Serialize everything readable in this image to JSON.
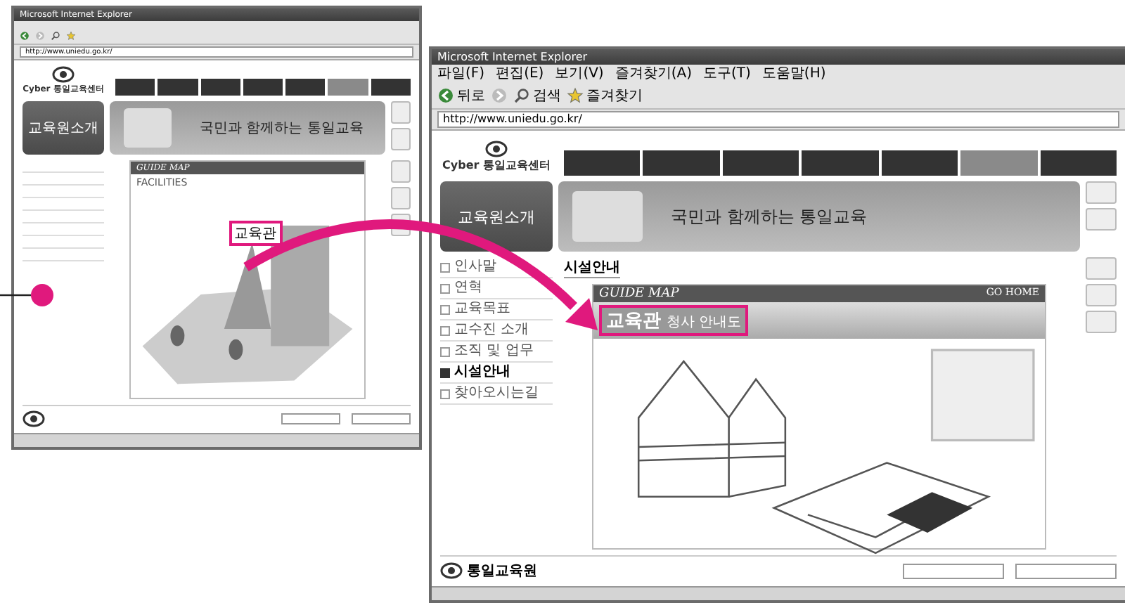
{
  "source_window": {
    "title": "Microsoft Internet Explorer",
    "nav_tabs": [
      {
        "selected": false
      },
      {
        "selected": false
      },
      {
        "selected": false
      },
      {
        "selected": false
      },
      {
        "selected": false
      },
      {
        "selected": true
      },
      {
        "selected": false
      }
    ],
    "toolbar": [
      {
        "kind": "back"
      },
      {
        "kind": "forward"
      },
      {
        "kind": "search"
      },
      {
        "kind": "favorites"
      }
    ],
    "address": "http://www.uniedu.go.kr/",
    "logo": "Cyber 통일교육센터",
    "section_title": "교육원소개",
    "banner_slogan": "국민과 함께하는 통일교육",
    "map_title": "GUIDE MAP",
    "map_subtitle": "FACILITIES",
    "callout": {
      "text": "교육관",
      "highlighted": true
    }
  },
  "target_window": {
    "title": "Microsoft Internet Explorer",
    "nav_tabs": [
      {
        "selected": false
      },
      {
        "selected": false
      },
      {
        "selected": false
      },
      {
        "selected": false
      },
      {
        "selected": false
      },
      {
        "selected": true
      },
      {
        "selected": false
      }
    ],
    "menu": [
      "파일(F)",
      "편집(E)",
      "보기(V)",
      "즐겨찾기(A)",
      "도구(T)",
      "도움말(H)"
    ],
    "toolbar": [
      {
        "kind": "back",
        "label": "뒤로"
      },
      {
        "kind": "forward"
      },
      {
        "kind": "search",
        "label": "검색"
      },
      {
        "kind": "favorites",
        "label": "즐겨찾기"
      }
    ],
    "address": "http://www.uniedu.go.kr/",
    "logo": "Cyber 통일교육센터",
    "section_title": "교육원소개",
    "banner_slogan": "국민과 함께하는 통일교육",
    "sidebar": [
      {
        "label": "인사말",
        "selected": false
      },
      {
        "label": "연혁",
        "selected": false
      },
      {
        "label": "교육목표",
        "selected": false
      },
      {
        "label": "교수진 소개",
        "selected": false
      },
      {
        "label": "조직 및 업무",
        "selected": false
      },
      {
        "label": "시설안내",
        "selected": true
      },
      {
        "label": "찾아오시는길",
        "selected": false
      }
    ],
    "page_heading": "시설안내",
    "map_title": "GUIDE MAP",
    "go_home": "GO HOME",
    "plan_heading": {
      "main": "교육관",
      "rest": "청사 안내도",
      "highlighted": true
    },
    "footer_logo": "통일교육원"
  }
}
